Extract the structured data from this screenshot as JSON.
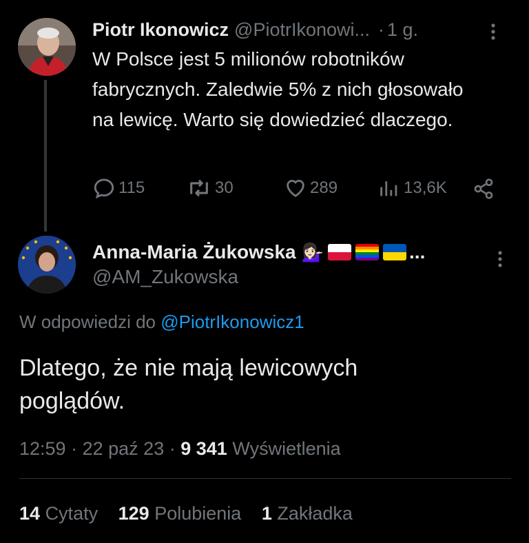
{
  "original_tweet": {
    "author_name": "Piotr Ikonowicz",
    "author_handle": "@PiotrIkonowi...",
    "time_sep": "·",
    "time": "1 g.",
    "text": "W Polsce jest 5 milionów robotników fabrycznych. Zaledwie 5% z nich głosowało na lewicę. Warto się dowiedzieć dlaczego.",
    "actions": {
      "replies": "115",
      "retweets": "30",
      "likes": "289",
      "views": "13,6K"
    },
    "more_label": "⋮"
  },
  "reply_tweet": {
    "author_name": "Anna-Maria Żukowska",
    "author_emoji": "💁🏻‍♀️",
    "name_ellipsis": "...",
    "author_handle": "@AM_Zukowska",
    "more_label": "⋮",
    "reply_prefix": "W odpowiedzi do",
    "reply_to": "@PiotrIkonowicz1",
    "text": "Dlatego, że nie mają lewicowych poglądów.",
    "time": "12:59",
    "sep": "·",
    "date": "22 paź 23",
    "views_count": "9 341",
    "views_label": "Wyświetlenia"
  },
  "stats": {
    "quotes_count": "14",
    "quotes_label": "Cytaty",
    "likes_count": "129",
    "likes_label": "Polubienia",
    "bookmarks_count": "1",
    "bookmarks_label": "Zakładka"
  },
  "colors": {
    "background": "#000000",
    "text": "#e7e9ea",
    "muted": "#71767b",
    "link": "#1d9bf0"
  }
}
